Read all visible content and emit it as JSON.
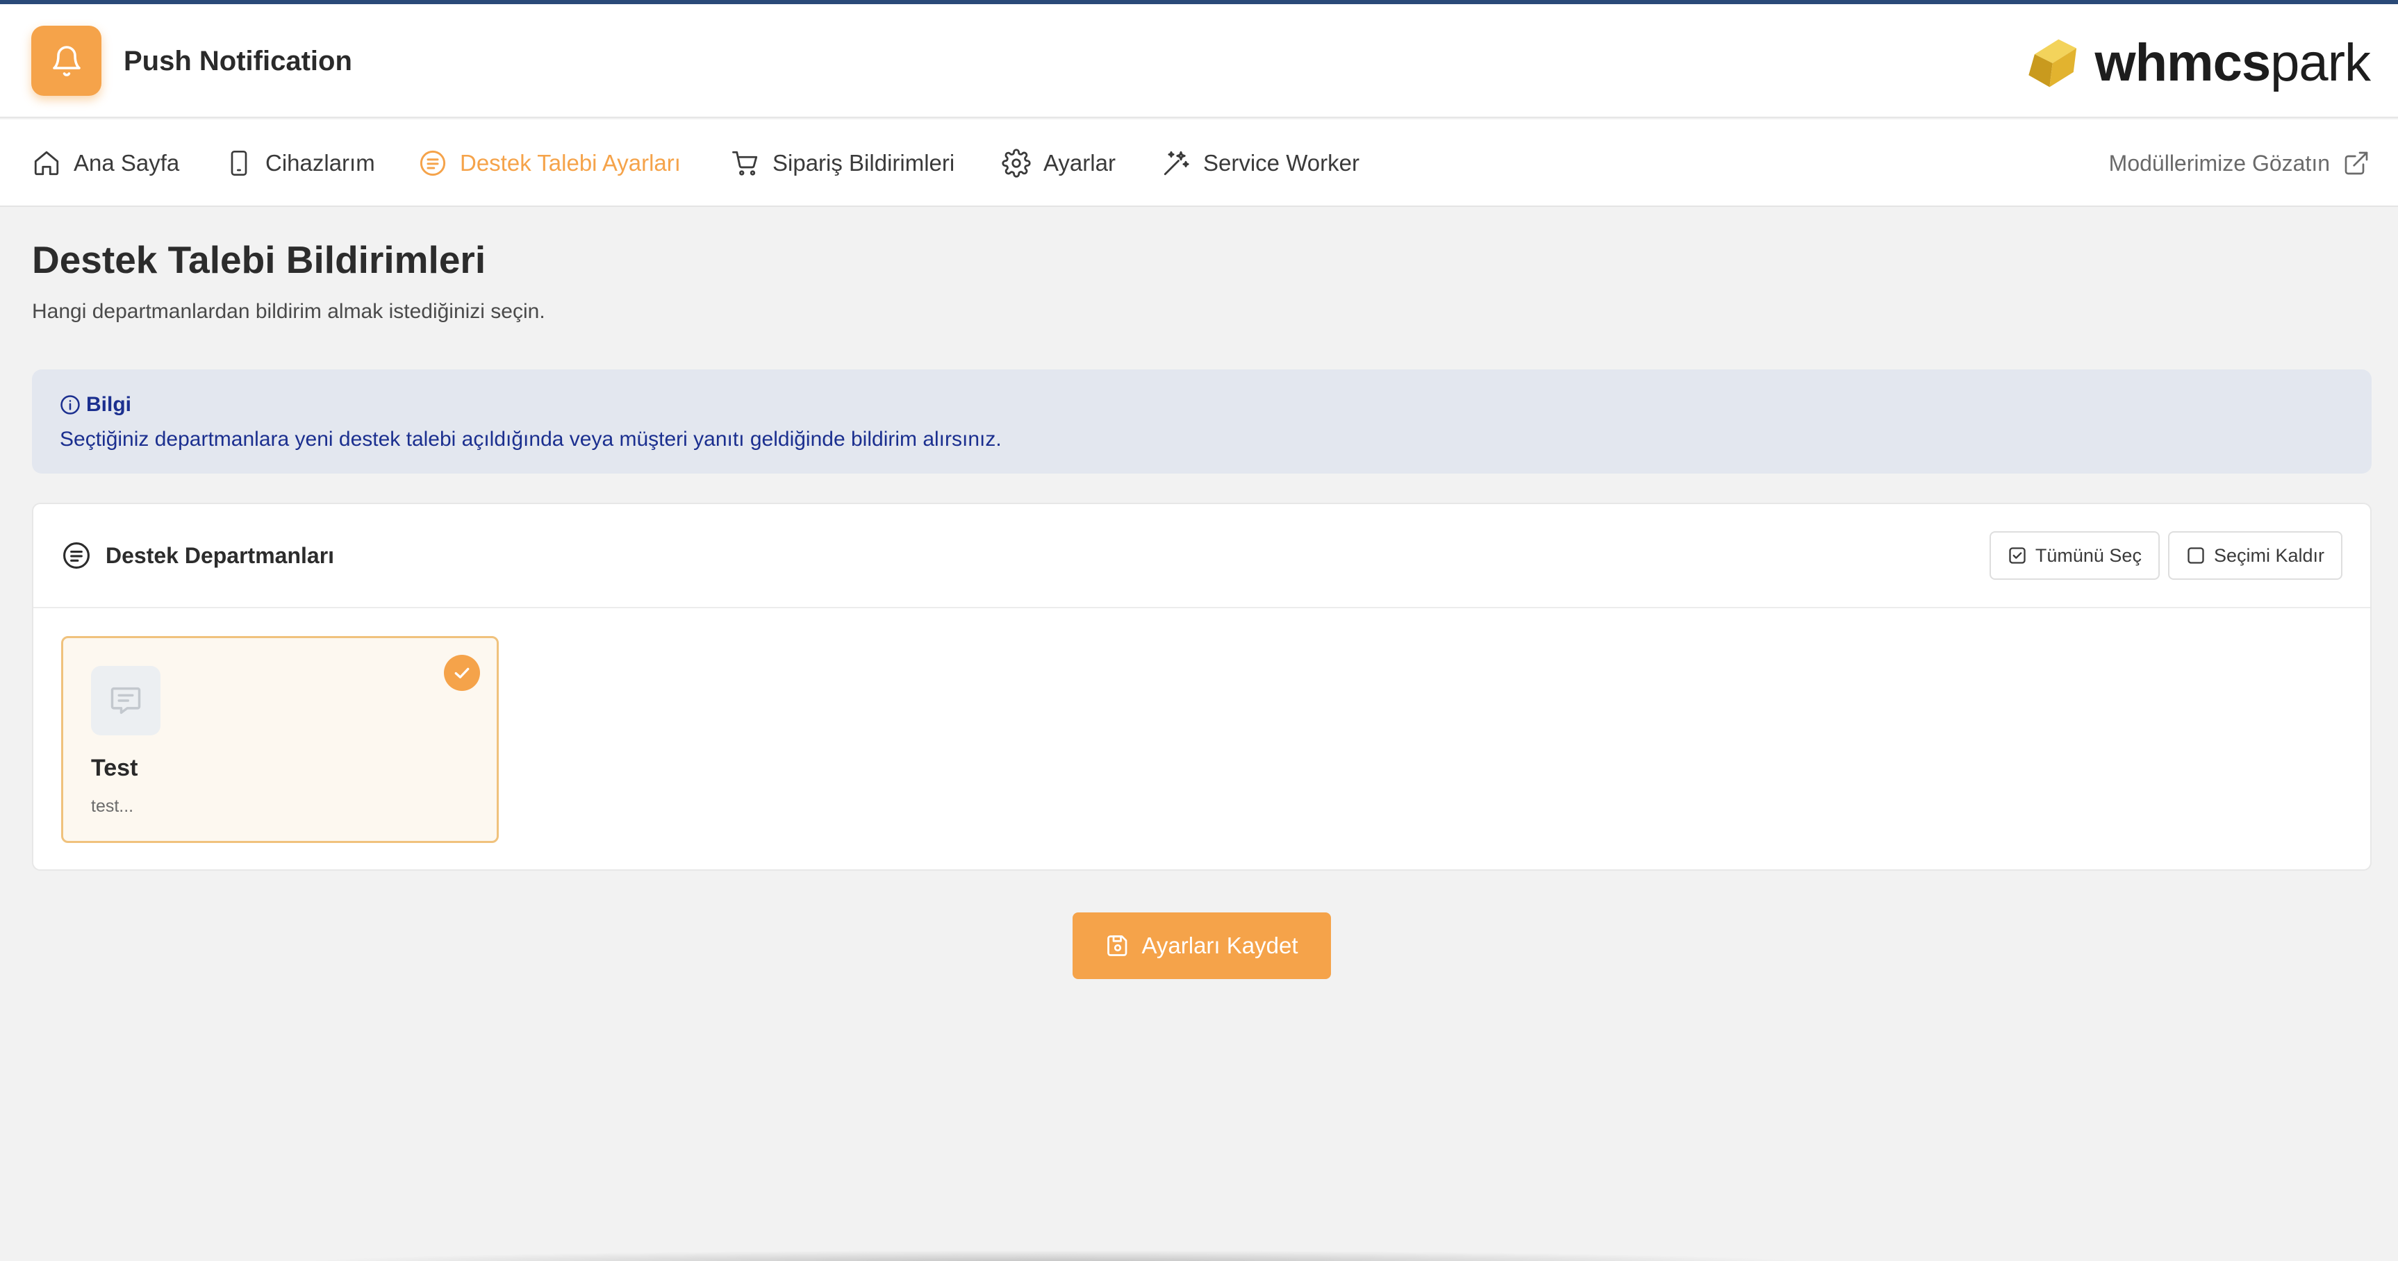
{
  "app": {
    "title": "Push Notification",
    "icon": "bell-icon",
    "accent_color": "#f5a34a"
  },
  "brand": {
    "logo_bold": "whmcs",
    "logo_light": "park",
    "logo_icon": "gold-cube-icon"
  },
  "nav": {
    "items": [
      {
        "label": "Ana Sayfa",
        "icon": "home-icon"
      },
      {
        "label": "Cihazlarım",
        "icon": "phone-icon"
      },
      {
        "label": "Destek Talebi Ayarları",
        "icon": "ticket-list-icon",
        "active": true
      },
      {
        "label": "Sipariş Bildirimleri",
        "icon": "cart-icon"
      },
      {
        "label": "Ayarlar",
        "icon": "gear-icon"
      },
      {
        "label": "Service Worker",
        "icon": "magic-wand-icon"
      }
    ],
    "external_link": {
      "label": "Modüllerimize Gözatın",
      "icon": "external-link-icon"
    }
  },
  "page": {
    "title": "Destek Talebi Bildirimleri",
    "subtitle": "Hangi departmanlardan bildirim almak istediğinizi seçin."
  },
  "info": {
    "heading": "Bilgi",
    "text": "Seçtiğiniz departmanlara yeni destek talebi açıldığında veya müşteri yanıtı geldiğinde bildirim alırsınız.",
    "color": "#1b2f8f",
    "background": "#e3e7ef"
  },
  "departments_card": {
    "title": "Destek Departmanları",
    "select_all_label": "Tümünü Seç",
    "deselect_label": "Seçimi Kaldır",
    "departments": [
      {
        "name": "Test",
        "description": "test...",
        "selected": true
      }
    ]
  },
  "actions": {
    "save_label": "Ayarları Kaydet"
  }
}
